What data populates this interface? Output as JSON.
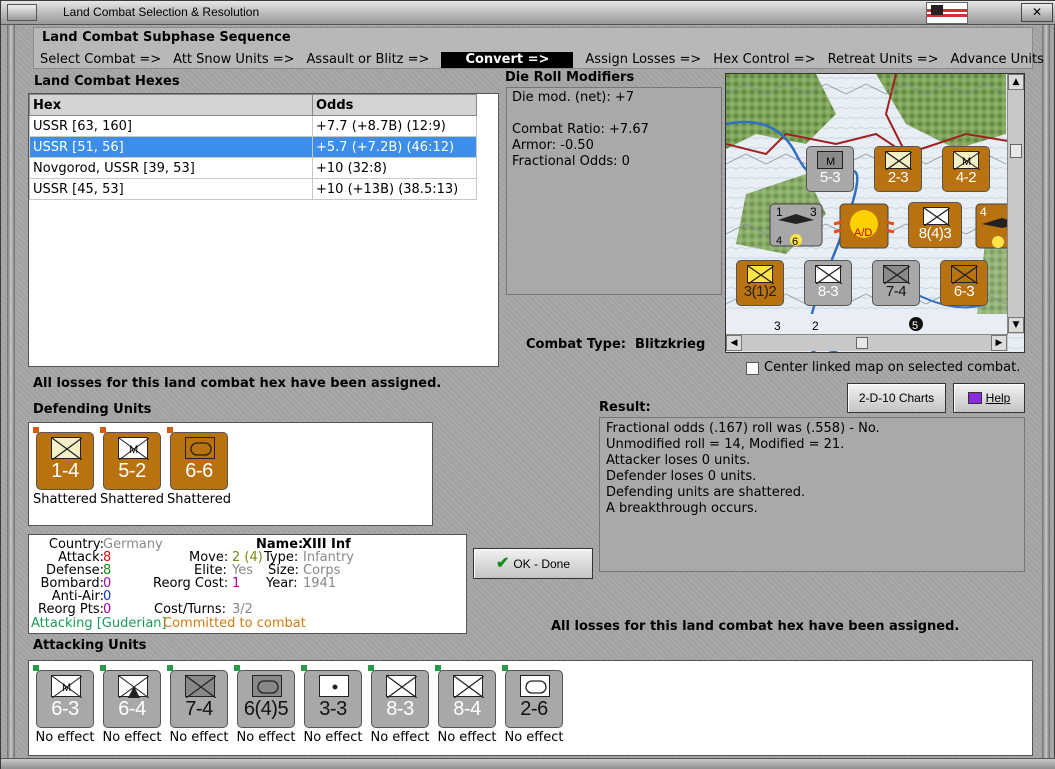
{
  "window": {
    "title": "Land Combat Selection & Resolution",
    "close_glyph": "✕"
  },
  "subphase": {
    "title": "Land Combat Subphase Sequence",
    "steps": [
      {
        "label": "Select Combat =>",
        "current": false
      },
      {
        "label": "Att Snow Units =>",
        "current": false
      },
      {
        "label": "Assault or Blitz =>",
        "current": false
      },
      {
        "label": "Convert =>",
        "current": true
      },
      {
        "label": "Assign Losses =>",
        "current": false
      },
      {
        "label": "Hex Control =>",
        "current": false
      },
      {
        "label": "Retreat Units =>",
        "current": false
      },
      {
        "label": "Advance Units",
        "current": false
      }
    ]
  },
  "hexes": {
    "title": "Land Combat Hexes",
    "col_hex": "Hex",
    "col_odds": "Odds",
    "rows": [
      {
        "hex": "USSR [63, 160]",
        "odds": "+7.7 (+8.7B) (12:9)",
        "selected": false
      },
      {
        "hex": "USSR [51, 56]",
        "odds": "+5.7 (+7.2B) (46:12)",
        "selected": true
      },
      {
        "hex": "Novgorod, USSR [39, 53]",
        "odds": "+10 (32:8)",
        "selected": false
      },
      {
        "hex": "USSR [45, 53]",
        "odds": "+10 (+13B) (38.5:13)",
        "selected": false
      }
    ]
  },
  "dierolls": {
    "title": "Die Roll Modifiers",
    "lines": [
      "Die mod. (net): +7",
      "",
      "Combat Ratio: +7.67",
      "Armor: -0.50",
      "Fractional Odds: 0"
    ]
  },
  "combat_type": {
    "label": "Combat Type:",
    "value": "Blitzkrieg"
  },
  "center_map": {
    "label": "Center linked map on selected combat.",
    "checked": false
  },
  "losses_msg": "All losses for this land combat hex have been assigned.",
  "buttons": {
    "charts": "2-D-10 Charts",
    "help": "Help",
    "ok": "OK - Done"
  },
  "result": {
    "title": "Result:",
    "lines": [
      "Fractional odds (.167) roll was (.558)  - No.",
      "Unmodified roll = 14, Modified = 21.",
      "Attacker loses 0 units.",
      "Defender loses 0 units.",
      "Defending units are shattered.",
      "A breakthrough occurs."
    ]
  },
  "defending": {
    "title": "Defending Units",
    "units": [
      {
        "value": "1-4",
        "symbol": "infantry",
        "status": "Shattered"
      },
      {
        "value": "5-2",
        "symbol": "motorized",
        "status": "Shattered"
      },
      {
        "value": "6-6",
        "symbol": "armor",
        "status": "Shattered"
      }
    ]
  },
  "info": {
    "country_k": "Country:",
    "country_v": "Germany",
    "attack_k": "Attack:",
    "attack_v": "8",
    "defense_k": "Defense:",
    "defense_v": "8",
    "bombard_k": "Bombard:",
    "bombard_v": "0",
    "antiair_k": "Anti-Air:",
    "antiair_v": "0",
    "reorg_k": "Reorg Pts:",
    "reorg_v": "0",
    "name_k": "Name:",
    "name_v": "XIII Inf",
    "move_k": "Move:",
    "move_v": "2 (4)",
    "type_k": "Type:",
    "type_v": "Infantry",
    "elite_k": "Elite:",
    "elite_v": "Yes",
    "size_k": "Size:",
    "size_v": "Corps",
    "reorgcost_k": "Reorg Cost:",
    "reorgcost_v": "1",
    "year_k": "Year:",
    "year_v": "1941",
    "cost_k": "Cost/Turns:",
    "cost_v": "3/2",
    "status_attacking": "Attacking [Guderian]",
    "status_committed": "Committed to combat"
  },
  "attacking": {
    "title": "Attacking Units",
    "units": [
      {
        "value": "6-3",
        "symbol": "motorized",
        "status": "No effect"
      },
      {
        "value": "6-4",
        "symbol": "mountain",
        "status": "No effect"
      },
      {
        "value": "7-4",
        "symbol": "infantry-dark",
        "status": "No effect"
      },
      {
        "value": "6(4)5",
        "symbol": "armor",
        "status": "No effect"
      },
      {
        "value": "3-3",
        "symbol": "hq",
        "status": "No effect"
      },
      {
        "value": "8-3",
        "symbol": "infantry",
        "status": "No effect"
      },
      {
        "value": "8-4",
        "symbol": "infantry",
        "status": "No effect"
      },
      {
        "value": "2-6",
        "symbol": "armor-light",
        "status": "No effect"
      }
    ]
  },
  "map_counters": [
    {
      "value": "5-3"
    },
    {
      "value": "2-3"
    },
    {
      "value": "4-2"
    },
    {
      "value": "8(4)3"
    },
    {
      "value": "3(1)2"
    },
    {
      "value": "8-3"
    },
    {
      "value": "7-4"
    },
    {
      "value": "6-3"
    }
  ],
  "colors": {
    "brown": "#b8720f",
    "gray": "#a8a8a8",
    "selection": "#3c8ee8",
    "attack": "#d11",
    "defense": "#1a8a1a",
    "bombard": "#b000b0",
    "antiair": "#1030d0"
  }
}
